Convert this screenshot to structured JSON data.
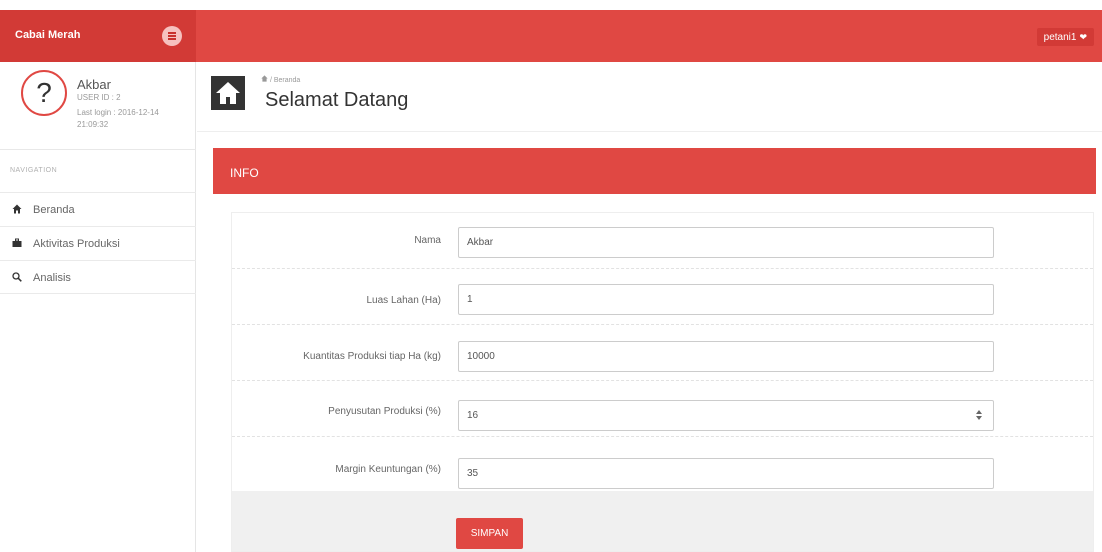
{
  "app": {
    "brand": "Cabai Merah",
    "user_menu": "petani1"
  },
  "sidebar": {
    "profile": {
      "name": "Akbar",
      "user_id": "USER ID : 2",
      "last_login": "Last login : 2016-12-14 21:09:32"
    },
    "nav_header": "NAVIGATION",
    "items": [
      {
        "label": "Beranda",
        "icon": "home-icon"
      },
      {
        "label": "Aktivitas Produksi",
        "icon": "briefcase-icon"
      },
      {
        "label": "Analisis",
        "icon": "search-icon"
      }
    ]
  },
  "header": {
    "breadcrumb": "Beranda",
    "title": "Selamat Datang"
  },
  "panel": {
    "title": "INFO",
    "fields": [
      {
        "label": "Nama",
        "value": "Akbar"
      },
      {
        "label": "Luas Lahan (Ha)",
        "value": "1"
      },
      {
        "label": "Kuantitas Produksi tiap Ha (kg)",
        "value": "10000"
      },
      {
        "label": "Penyusutan Produksi (%)",
        "value": "16"
      },
      {
        "label": "Margin Keuntungan (%)",
        "value": "35"
      }
    ],
    "submit_label": "SIMPAN"
  },
  "colors": {
    "accent": "#e04843",
    "accent_dark": "#d23a36"
  }
}
